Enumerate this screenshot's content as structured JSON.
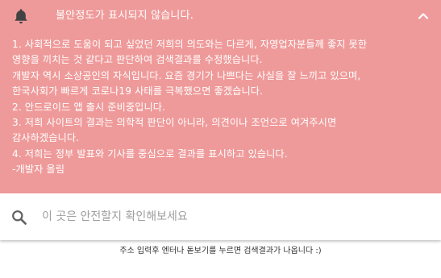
{
  "colors": {
    "notice_bg": "#ef9a9a",
    "notice_text": "#ffffff",
    "placeholder": "#9e9e9e"
  },
  "notice": {
    "icon": "bell-icon",
    "title": "불안정도가 표시되지 않습니다.",
    "toggle_icon": "chevron-up-icon",
    "lines": [
      "1. 사회적으로 도움이 되고 싶었던 저희의 의도와는 다르게, 자영업자분들께 좋지 못한",
      "영향을 끼치는 것 같다고 판단하여 검색결과를 수정했습니다.",
      "개발자 역시 소상공인의 자식입니다. 요즘 경기가 나쁘다는 사실을 잘 느끼고 있으며,",
      "한국사회가 빠르게 코로나19 사태를 극복했으면 좋겠습니다.",
      "2. 안드로이드 앱 출시 준비중입니다.",
      "3. 저희 사이트의 결과는 의학적 판단이 아니라, 의견이나 조언으로 여겨주시면",
      "감사하겠습니다.",
      "4. 저희는 정부 발표와 기사를 중심으로 결과를 표시하고 있습니다.",
      "-개발자 올림"
    ]
  },
  "search": {
    "icon": "search-icon",
    "placeholder": "이 곳은 안전할지 확인해보세요",
    "value": ""
  },
  "hint": {
    "text": "주소 입력후 엔터나 돋보기를 누르면 검색결과가 나옵니다 :)"
  }
}
